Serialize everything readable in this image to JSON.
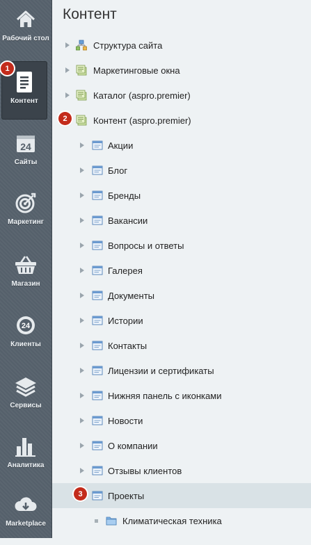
{
  "sidebar": {
    "items": [
      {
        "label": "Рабочий стол",
        "icon": "home-icon"
      },
      {
        "label": "Контент",
        "icon": "document-icon",
        "active": true
      },
      {
        "label": "Сайты",
        "icon": "calendar-24-icon"
      },
      {
        "label": "Маркетинг",
        "icon": "target-icon"
      },
      {
        "label": "Магазин",
        "icon": "basket-icon"
      },
      {
        "label": "Клиенты",
        "icon": "cloud-24-icon"
      },
      {
        "label": "Сервисы",
        "icon": "layers-icon"
      },
      {
        "label": "Аналитика",
        "icon": "bar-chart-icon"
      },
      {
        "label": "Marketplace",
        "icon": "cloud-download-icon"
      }
    ]
  },
  "main": {
    "title": "Контент",
    "tree": [
      {
        "label": "Структура сайта",
        "icon": "sitemap-icon",
        "level": 0
      },
      {
        "label": "Маркетинговые окна",
        "icon": "iblock-type-icon",
        "level": 0
      },
      {
        "label": "Каталог (aspro.premier)",
        "icon": "iblock-type-icon",
        "level": 0
      },
      {
        "label": "Контент (aspro.premier)",
        "icon": "iblock-type-icon",
        "level": 0
      },
      {
        "label": "Акции",
        "icon": "iblock-icon",
        "level": 1
      },
      {
        "label": "Блог",
        "icon": "iblock-icon",
        "level": 1
      },
      {
        "label": "Бренды",
        "icon": "iblock-icon",
        "level": 1
      },
      {
        "label": "Вакансии",
        "icon": "iblock-icon",
        "level": 1
      },
      {
        "label": "Вопросы и ответы",
        "icon": "iblock-icon",
        "level": 1
      },
      {
        "label": "Галерея",
        "icon": "iblock-icon",
        "level": 1
      },
      {
        "label": "Документы",
        "icon": "iblock-icon",
        "level": 1
      },
      {
        "label": "Истории",
        "icon": "iblock-icon",
        "level": 1
      },
      {
        "label": "Контакты",
        "icon": "iblock-icon",
        "level": 1
      },
      {
        "label": "Лицензии и сертификаты",
        "icon": "iblock-icon",
        "level": 1
      },
      {
        "label": "Нижняя панель с иконками",
        "icon": "iblock-icon",
        "level": 1
      },
      {
        "label": "Новости",
        "icon": "iblock-icon",
        "level": 1
      },
      {
        "label": "О компании",
        "icon": "iblock-icon",
        "level": 1
      },
      {
        "label": "Отзывы клиентов",
        "icon": "iblock-icon",
        "level": 1
      },
      {
        "label": "Проекты",
        "icon": "iblock-icon",
        "level": 1,
        "selected": true
      },
      {
        "label": "Климатическая техника",
        "icon": "folder-icon",
        "level": 2
      }
    ]
  },
  "annotations": {
    "badge1": "1",
    "badge2": "2",
    "badge3": "3"
  },
  "colors": {
    "sidebar_bg": "#55606b",
    "sidebar_active": "#3b434b",
    "main_bg": "#eef2f4",
    "selected_row": "#d9e2e6",
    "badge": "#c32b1b"
  }
}
